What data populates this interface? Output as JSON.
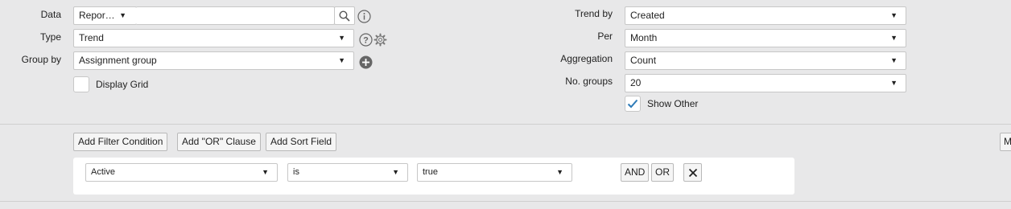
{
  "form": {
    "left": {
      "data_label": "Data",
      "data_source": "Repor…",
      "data_table": "",
      "type_label": "Type",
      "type_value": "Trend",
      "groupby_label": "Group by",
      "groupby_value": "Assignment group",
      "display_grid_label": "Display Grid",
      "display_grid_checked": false
    },
    "right": {
      "trendby_label": "Trend by",
      "trendby_value": "Created",
      "per_label": "Per",
      "per_value": "Month",
      "aggregation_label": "Aggregation",
      "aggregation_value": "Count",
      "nogroups_label": "No. groups",
      "nogroups_value": "20",
      "show_other_label": "Show Other",
      "show_other_checked": true
    }
  },
  "filter": {
    "buttons": {
      "add_filter": "Add Filter Condition",
      "add_or": "Add \"OR\" Clause",
      "add_sort": "Add Sort Field",
      "more_partial": "M"
    },
    "condition": {
      "field": "Active",
      "operator": "is",
      "value": "true",
      "and_label": "AND",
      "or_label": "OR"
    }
  },
  "icons": {
    "search": "search-icon",
    "info": "info-icon",
    "help": "help-icon",
    "gear": "gear-icon",
    "add": "add-icon",
    "close": "close-icon",
    "check": "check-icon",
    "caret": "chevron-down-icon"
  },
  "colors": {
    "page_bg": "#e8e8e9",
    "check_accent": "#2e7bb8"
  }
}
